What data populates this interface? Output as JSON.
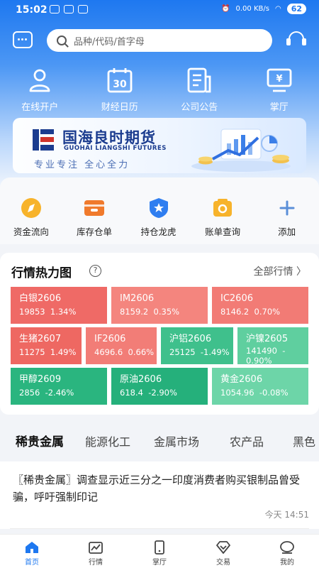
{
  "status_bar": {
    "time": "15:02",
    "battery": "62",
    "net": "0.00 KB/s"
  },
  "search": {
    "placeholder": "品种/代码/首字母"
  },
  "quick_actions": [
    "在线开户",
    "财经日历",
    "公司公告",
    "掌厅"
  ],
  "calendar_day": "30",
  "banner": {
    "title": "国海良时期货",
    "subtitle_en": "GUOHAI LIANGSHI FUTURES",
    "slogan": "专业专注  全心全力"
  },
  "tools": [
    "资金流向",
    "库存仓单",
    "持仓龙虎",
    "账单查询",
    "添加"
  ],
  "heatmap": {
    "title": "行情热力图",
    "help_icon": "?",
    "more": "全部行情",
    "tiles": [
      {
        "name": "白银2606",
        "value": "19853  1.34%",
        "color": "#ef6a66"
      },
      {
        "name": "IM2606",
        "value": "8159.2  0.35%",
        "color": "#f4857e"
      },
      {
        "name": "IC2606",
        "value": "8146.2  0.70%",
        "color": "#f27b75"
      },
      {
        "name": "生猪2607",
        "value": "11275  1.49%",
        "color": "#ee6862"
      },
      {
        "name": "IF2606",
        "value": "4696.6  0.66%",
        "color": "#f27d77"
      },
      {
        "name": "沪铝2606",
        "value": "25125  -1.49%",
        "color": "#3fc08c"
      },
      {
        "name": "沪镍2605",
        "value": "141490  -\n0.90%",
        "color": "#5fcf9f"
      },
      {
        "name": "甲醇2609",
        "value": "2856  -2.46%",
        "color": "#2ab57f"
      },
      {
        "name": "原油2606",
        "value": "618.4  -2.90%",
        "color": "#25b07b"
      },
      {
        "name": "黄金2606",
        "value": "1054.96  -0.08%",
        "color": "#6dd5a8"
      }
    ]
  },
  "news_tabs": [
    "稀贵金属",
    "能源化工",
    "金属市场",
    "农产品",
    "黑色"
  ],
  "news": [
    {
      "text": "〖稀贵金属〗调查显示近三分之一印度消费者购买银制品曾受骗，呼吁强制印记",
      "time": "今天 14:51"
    }
  ],
  "bottom_nav": [
    "首页",
    "行情",
    "掌厅",
    "交易",
    "我的"
  ],
  "colors": {
    "primary": "#1e78f0",
    "up": "#ef6a66",
    "down": "#3fc08c"
  }
}
